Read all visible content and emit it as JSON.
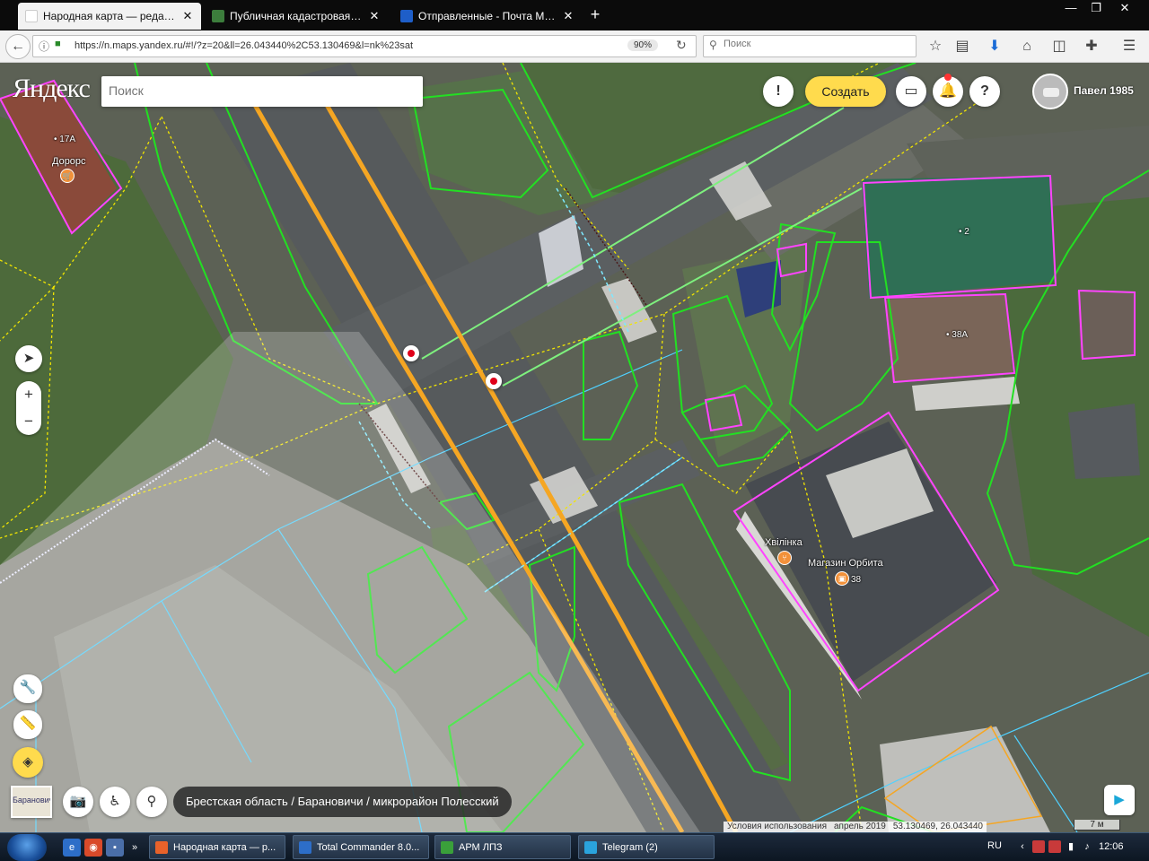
{
  "browser": {
    "tabs": [
      {
        "title": "Народная карта — редакто...",
        "color": "#f5f5f5",
        "active": true
      },
      {
        "title": "Публичная кадастровая ка...",
        "color": "#3c7d3c",
        "active": false
      },
      {
        "title": "Отправленные - Почта Mail.ru",
        "color": "#1e5ec8",
        "active": false
      }
    ],
    "new_tab": "+",
    "url": "https://n.maps.yandex.ru/#!/?z=20&ll=26.043440%2C53.130469&l=nk%23sat",
    "zoom": "90%",
    "search_placeholder": "Поиск"
  },
  "map": {
    "logo": "Яндекс",
    "search_placeholder": "Поиск",
    "create_label": "Создать",
    "user_name": "Павел 1985",
    "buttons": {
      "alert": "!",
      "help": "?"
    },
    "zoom_in": "+",
    "zoom_out": "−",
    "mini_map_label": "Барановичи",
    "breadcrumb": "Брестская область / Барановичи / микрорайон Полесский",
    "copyright": {
      "terms": "Условия использования",
      "date": "апрель 2019",
      "coords": "53.130469, 26.043440"
    },
    "scale": "7 м",
    "labels": {
      "b17a": "17А",
      "dorors": "Дорорс",
      "b2": "2",
      "b38a": "38А",
      "khvilinka": "Хвілінка",
      "orbita": "Магазин Орбита",
      "b38": "38"
    }
  },
  "taskbar": {
    "tasks": [
      {
        "title": "Народная карта — р...",
        "color": "#e8622a"
      },
      {
        "title": "Total Commander 8.0...",
        "color": "#2d6ec8"
      },
      {
        "title": "АРМ ЛПЗ",
        "color": "#3aa03a"
      },
      {
        "title": "Telegram (2)",
        "color": "#2aa3dd"
      }
    ],
    "lang": "RU",
    "time": "12:06"
  },
  "colors": {
    "accent": "#ffdb4d",
    "road": "#f5a623",
    "parcel": "#22e022",
    "building": "#ff44ff",
    "cadastre": "#4fd1ff"
  }
}
